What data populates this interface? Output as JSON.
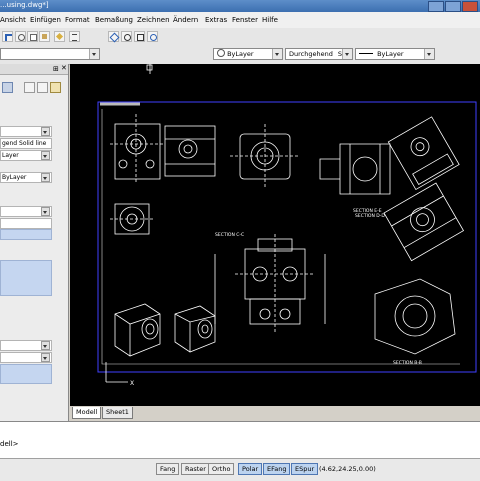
{
  "window": {
    "title": "...using.dwg*]"
  },
  "menu": [
    "Ansicht",
    "Einfügen",
    "Format",
    "Bemaßung",
    "Zeichnen",
    "Ändern",
    "Extras",
    "Fenster",
    "Hilfe"
  ],
  "properties_toolbar": {
    "color": "ByLayer",
    "linetype": "Durchgehend",
    "linetype_suffix": "Soli",
    "lineweight": "ByLayer"
  },
  "left_panel": {
    "row_linetype": "gend   Solid line",
    "row_bylayer_1": "ByLayer",
    "row_bylayer_2": "Layer"
  },
  "drawing_labels": {
    "section_a": "SECTION C-C",
    "section_b": "SECTION E-E",
    "section_c": "SECTION D-D",
    "section_d": "SECTION B-B"
  },
  "tabs": [
    "Modell",
    "Sheet1"
  ],
  "command": {
    "prompt": "dell>"
  },
  "status": {
    "buttons": [
      {
        "label": "Fang",
        "on": false
      },
      {
        "label": "Raster",
        "on": false
      },
      {
        "label": "Ortho",
        "on": false
      },
      {
        "label": "Polar",
        "on": true
      },
      {
        "label": "EFang",
        "on": true
      },
      {
        "label": "ESpur",
        "on": true
      }
    ],
    "coordinates": "(4.62,24.25,0.00)"
  },
  "colors": {
    "accent": "#3c6fb0",
    "drawing_bg": "#000000",
    "frame": "#4040ff",
    "lines": "#ffffff"
  }
}
